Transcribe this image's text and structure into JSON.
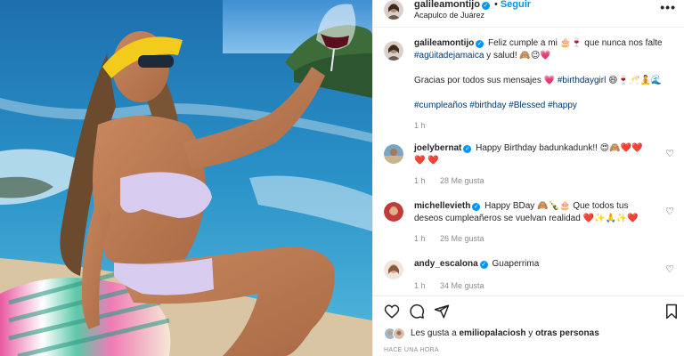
{
  "post": {
    "username": "galileamontijo",
    "dot": "•",
    "follow_label": "Seguir",
    "location": "Acapulco de Juárez",
    "more_icon": "more-horizontal-icon",
    "verified_symbol": "✓"
  },
  "caption": {
    "username": "galileamontijo",
    "text1": "Feliz cumple a mi 🎂🍷 que nunca nos falte",
    "hashtag1": "#agüitadejamaica",
    "text2": " y salud! 🙈😉💗",
    "line2": "Gracias por todos sus mensajes 💗",
    "hashtag2": "#birthdaygirl",
    "line2_end": " 😄🍷🥂🧘🌊",
    "hashtags": "#cumpleaños #birthday #Blessed #happy",
    "time": "1 h"
  },
  "comments": [
    {
      "username": "joelybernat",
      "text": "Happy Birthday badunkadunk!! 😍🙈❤️❤️❤️ ❤️",
      "time": "1 h",
      "likes": "28 Me gusta"
    },
    {
      "username": "michellevieth",
      "text": "Happy BDay 🙈🍾🎂 Que todos tus deseos cumpleañeros se vuelvan realidad ❤️✨🙏✨❤️",
      "time": "1 h",
      "likes": "26 Me gusta"
    },
    {
      "username": "andy_escalona",
      "text": "Guaperrima",
      "time": "1 h",
      "likes": "34 Me gusta"
    }
  ],
  "likes": {
    "prefix": "Les gusta a ",
    "user": "emiliopalaciosh",
    "connector": " y ",
    "others": "otras personas"
  },
  "timestamp": "HACE UNA HORA",
  "colors": {
    "accent": "#0095f6",
    "hashtag": "#00376b",
    "muted": "#8e8e8e"
  },
  "icons": [
    "heart-icon",
    "comment-icon",
    "share-icon",
    "bookmark-icon"
  ]
}
